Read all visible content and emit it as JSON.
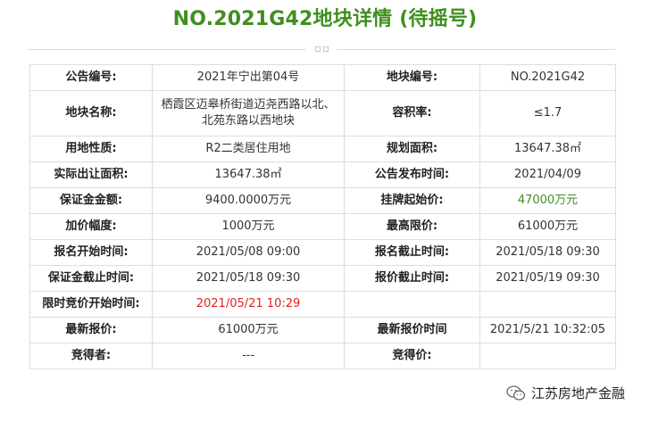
{
  "title": "NO.2021G42地块详情 (待摇号)",
  "rows": [
    {
      "l1": "公告编号:",
      "v1": "2021年宁出第04号",
      "l2": "地块编号:",
      "v2": "NO.2021G42"
    },
    {
      "l1": "地块名称:",
      "v1": "栖霞区迈皋桥街道迈尧西路以北、北苑东路以西地块",
      "l2": "容积率:",
      "v2": "≤1.7"
    },
    {
      "l1": "用地性质:",
      "v1": "R2二类居住用地",
      "l2": "规划面积:",
      "v2": "13647.38㎡"
    },
    {
      "l1": "实际出让面积:",
      "v1": "13647.38㎡",
      "l2": "公告发布时间:",
      "v2": "2021/04/09"
    },
    {
      "l1": "保证金金额:",
      "v1": "9400.0000万元",
      "l2": "挂牌起始价:",
      "v2": "47000万元"
    },
    {
      "l1": "加价幅度:",
      "v1": "1000万元",
      "l2": "最高限价:",
      "v2": "61000万元"
    },
    {
      "l1": "报名开始时间:",
      "v1": "2021/05/08 09:00",
      "l2": "报名截止时间:",
      "v2": "2021/05/18 09:30"
    },
    {
      "l1": "保证金截止时间:",
      "v1": "2021/05/18 09:30",
      "l2": "报价截止时间:",
      "v2": "2021/05/19 09:30"
    },
    {
      "l1": "限时竞价开始时间:",
      "v1": "2021/05/21 10:29",
      "l2": "",
      "v2": ""
    },
    {
      "l1": "最新报价:",
      "v1": "61000万元",
      "l2": "最新报价时间",
      "v2": "2021/5/21 10:32:05"
    },
    {
      "l1": "竞得者:",
      "v1": "---",
      "l2": "竞得价:",
      "v2": ""
    }
  ],
  "colors": {
    "title": "#3f8f1f",
    "start_price": "#3f8f1f",
    "bidding_start": "#e02020"
  },
  "watermark": {
    "icon": "wechat-icon",
    "text": "江苏房地产金融"
  }
}
